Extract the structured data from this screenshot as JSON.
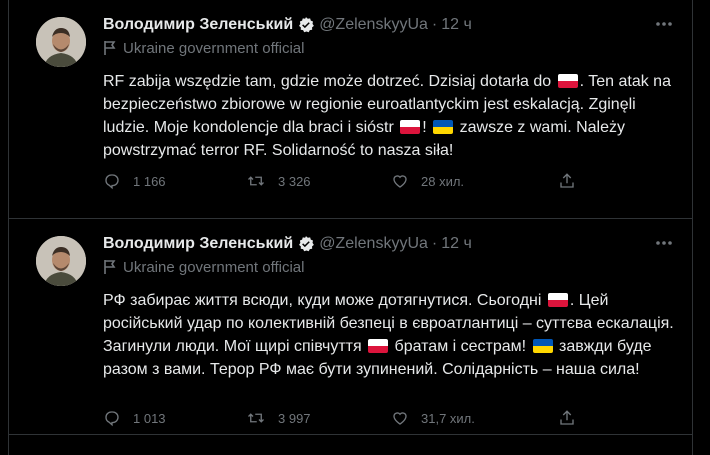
{
  "tweets": [
    {
      "name": "Володимир Зеленський",
      "handle": "@ZelenskyyUa",
      "separator": "·",
      "time": "12 ч",
      "label": "Ukraine government official",
      "text": {
        "p1": "RF zabija wszędzie tam, gdzie może dotrzeć. Dzisiaj dotarła do",
        "p2": ". Ten atak na bezpieczeństwo zbiorowe w regionie euroatlantyckim jest eskalacją. Zginęli ludzie. Moje kondolencje dla braci i sióstr",
        "p3": "!",
        "p4": "zawsze z wami. Należy powstrzymać terror RF.  Solidarność to nasza siła!"
      },
      "replies": "1 166",
      "retweets": "3 326",
      "views": "28 хил."
    },
    {
      "name": "Володимир Зеленський",
      "handle": "@ZelenskyyUa",
      "separator": "·",
      "time": "12 ч",
      "label": "Ukraine government official",
      "text": {
        "p1": "РФ забирає життя всюди, куди може дотягнутися. Сьогодні",
        "p2": ". Цей російський удар по колективній безпеці в євроатлантиці – суттєва ескалація. Загинули люди. Мої щирі співчуття",
        "p3": "братам і сестрам!",
        "p4": "завжди буде разом з вами. Терор РФ має бути зупинений. Солідарність – наша сила!"
      },
      "replies": "1 013",
      "retweets": "3 997",
      "views": "31,7 хил."
    }
  ],
  "icons": {
    "verified": "verified-badge-icon",
    "government": "flag-outline-icon",
    "more": "more-dots-icon",
    "reply": "reply-icon",
    "retweet": "retweet-icon",
    "like": "heart-icon",
    "share": "share-icon"
  },
  "colors": {
    "background": "#000000",
    "text": "#e7e9ea",
    "muted": "#71767b",
    "divider": "#2f3336",
    "verified": "#e7e9ea"
  }
}
